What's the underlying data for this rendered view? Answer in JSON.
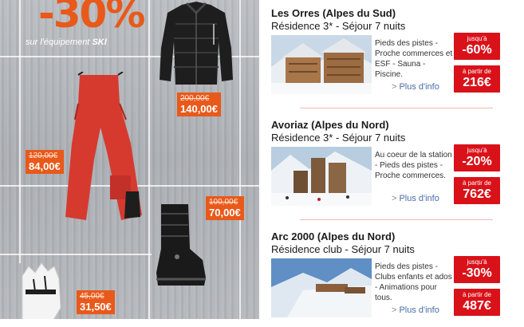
{
  "promo": {
    "discount": "-30%",
    "subtitle_prefix": "sur l'équipement",
    "subtitle_bold": "SKI",
    "products": [
      {
        "name": "jacket",
        "old_price": "200,00€",
        "new_price": "140,00€"
      },
      {
        "name": "pants",
        "old_price": "120,00€",
        "new_price": "84,00€"
      },
      {
        "name": "boots",
        "old_price": "100,00€",
        "new_price": "70,00€"
      },
      {
        "name": "gloves",
        "old_price": "45,00€",
        "new_price": "31,50€"
      }
    ]
  },
  "offers": [
    {
      "title": "Les Orres (Alpes du Sud)",
      "subtitle": "Résidence 3* - Séjour 7 nuits",
      "description": "Pieds des pistes - Proche commerces et ESF - Sauna - Piscine.",
      "more_link": "Plus d'info",
      "discount_label": "jusqu'à",
      "discount": "-60%",
      "price_label": "à partir de",
      "price": "216€"
    },
    {
      "title": "Avoriaz (Alpes du Nord)",
      "subtitle": "Résidence 3* - Séjour 7 nuits",
      "description": "Au coeur de la station - Pieds des pistes - Proche commerces.",
      "more_link": "Plus d'info",
      "discount_label": "jusqu'à",
      "discount": "-20%",
      "price_label": "à partir de",
      "price": "762€"
    },
    {
      "title": "Arc 2000 (Alpes du Nord)",
      "subtitle": "Résidence club - Séjour 7 nuits",
      "description": "Pieds des pistes - Clubs enfants et ados - Animations pour tous.",
      "more_link": "Plus d'info",
      "discount_label": "jusqu'à",
      "discount": "-30%",
      "price_label": "à partir de",
      "price": "487€"
    }
  ],
  "colors": {
    "promo_orange": "#e8591a",
    "badge_red": "#d9121a",
    "link_blue": "#4a6aa8",
    "divider_pink": "#f2b9b2"
  }
}
